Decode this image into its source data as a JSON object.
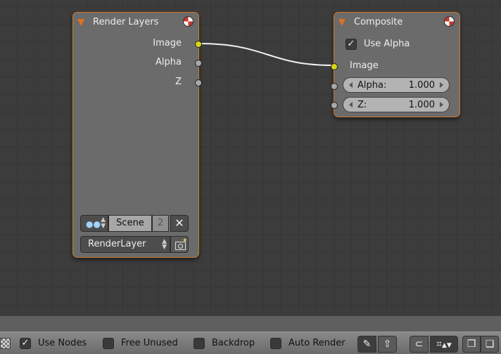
{
  "nodes": {
    "render_layers": {
      "title": "Render Layers",
      "outputs": [
        "Image",
        "Alpha",
        "Z"
      ],
      "scene_name": "Scene",
      "scene_users": "2",
      "scene_close": "✕",
      "layer_name": "RenderLayer"
    },
    "composite": {
      "title": "Composite",
      "use_alpha_label": "Use Alpha",
      "use_alpha_check": "✓",
      "image_input": "Image",
      "alpha_label": "Alpha:",
      "alpha_value": "1.000",
      "z_label": "Z:",
      "z_value": "1.000"
    }
  },
  "header": {
    "use_nodes_label": "Use Nodes",
    "use_nodes_check": "✓",
    "free_unused_label": "Free Unused",
    "backdrop_label": "Backdrop",
    "auto_render_label": "Auto Render"
  },
  "icons": {
    "pin": "pin-icon",
    "go_parent": "go-to-parent-icon",
    "snap": "snap-icon",
    "snap_element": "snap-element-icon",
    "copy": "copy-icon",
    "paste": "paste-icon"
  },
  "colors": {
    "node_border": "#d07a2a",
    "socket_image": "#d8d418",
    "socket_value": "#a8a8a8",
    "canvas": "#3c3c3c"
  }
}
